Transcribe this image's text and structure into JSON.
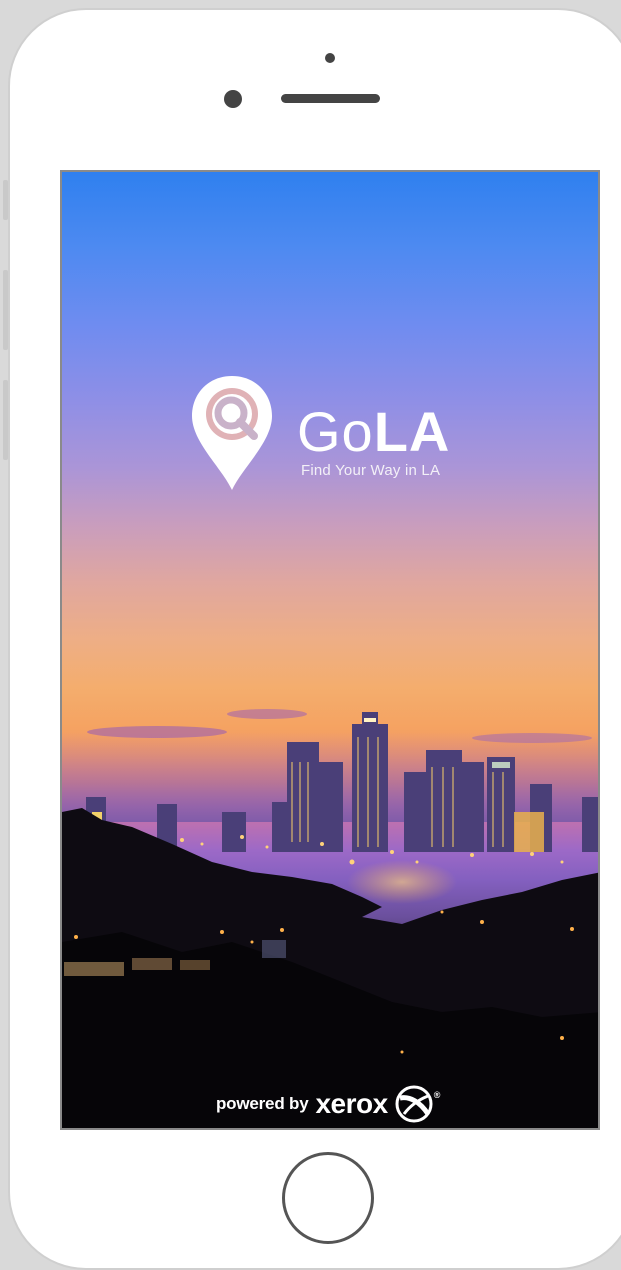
{
  "device": {
    "frame_color": "#ffffff",
    "background_color": "#d9d9d9"
  },
  "splash": {
    "app_name_part1": "Go",
    "app_name_part2": "LA",
    "tagline": "Find Your Way in LA",
    "logo_icon": "map-pin-search-icon",
    "footer": {
      "powered_by": "powered by",
      "brand": "xerox",
      "brand_icon": "xerox-globe-icon",
      "brand_mark": "®"
    },
    "colors": {
      "sky_top": "#2f80ef",
      "sky_mid": "#f4ad6d",
      "horizon": "#9c69c7",
      "foreground": "#050406"
    }
  }
}
